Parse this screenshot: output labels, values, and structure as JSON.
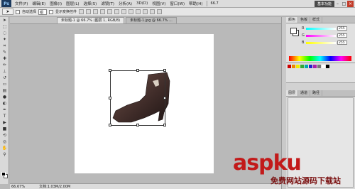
{
  "app": {
    "logo": "Ps",
    "workspace": "基本功能"
  },
  "menu": [
    "文件(F)",
    "编辑(E)",
    "图像(I)",
    "图层(L)",
    "选择(S)",
    "滤镜(T)",
    "分析(A)",
    "3D(D)",
    "视图(V)",
    "窗口(W)",
    "帮助(H)"
  ],
  "menubar_extra": {
    "zoom": "66.7"
  },
  "options": {
    "auto_select_label": "自动选择",
    "auto_select_target": "组",
    "show_transform_label": "显示变换控件"
  },
  "document": {
    "tab_active": "未标题-1 @ 66.7% (图层 1, RGB/8)",
    "tab_inactive": "未标题-1.jpg @ 66.7% ...",
    "zoom": "66.67%",
    "doc_info": "文档:1.03M/2.00M"
  },
  "color_panel": {
    "tabs": [
      "颜色",
      "色板",
      "样式"
    ],
    "r_label": "R",
    "g_label": "G",
    "b_label": "B",
    "r_value": "255",
    "g_value": "255",
    "b_value": "255"
  },
  "layers_panel": {
    "tabs": [
      "图层",
      "通道",
      "路径"
    ]
  },
  "watermark": {
    "main": "aspku",
    "sub": "免费网站源码下载站"
  }
}
